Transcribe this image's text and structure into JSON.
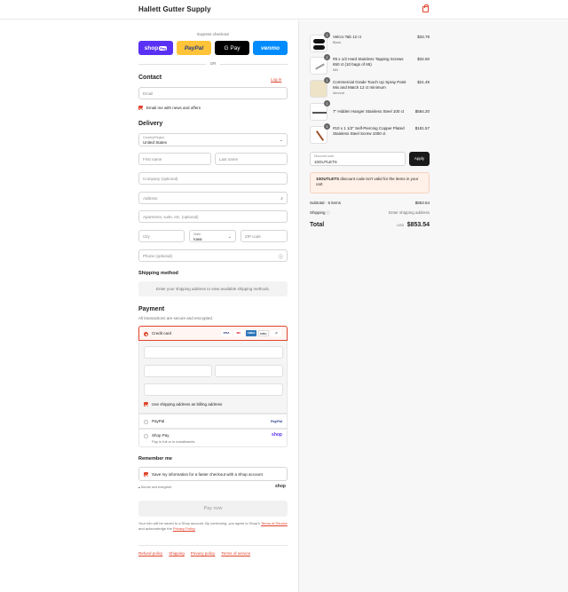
{
  "header": {
    "brand": "Hallett Gutter Supply"
  },
  "express": {
    "label": "Express checkout",
    "shoppay": "shop",
    "shoppay_badge": "Pay",
    "paypal": "PayPal",
    "gpay": "G Pay",
    "venmo": "venmo",
    "or": "OR"
  },
  "contact": {
    "title": "Contact",
    "login": "Log in",
    "email_placeholder": "Email",
    "news_label": "Email me with news and offers"
  },
  "delivery": {
    "title": "Delivery",
    "country_label": "Country/Region",
    "country_value": "United States",
    "first_name": "First name",
    "last_name": "Last name",
    "company": "Company (optional)",
    "address": "Address",
    "apartment": "Apartment, suite, etc. (optional)",
    "city": "City",
    "state_label": "State",
    "state_value": "Iowa",
    "zip": "ZIP code",
    "phone": "Phone (optional)"
  },
  "shipping": {
    "title": "Shipping method",
    "note": "Enter your shipping address to view available shipping methods."
  },
  "payment": {
    "title": "Payment",
    "subtitle": "All transactions are secure and encrypted.",
    "credit_card": "Credit card",
    "card_logos": [
      "VISA",
      "MC",
      "AMEX",
      "DISC",
      "+5"
    ],
    "billing_label": "Use shipping address as billing address",
    "paypal_label": "PayPal",
    "paypal_logo": "PayPal",
    "shoppay_label": "Shop Pay",
    "shoppay_sub": "Pay in full or in installments",
    "shoppay_logo": "shop"
  },
  "remember": {
    "title": "Remember me",
    "save_label": "Save my information for a faster checkout with a Shop account",
    "secure": "Secure and encrypted",
    "shop_logo": "shop"
  },
  "pay_now": "Pay now",
  "legal": {
    "text": "Your info will be saved to a Shop account. By continuing, you agree to Shop's",
    "terms": "Terms of Service",
    "and": "and acknowledge the",
    "privacy": "Privacy Policy"
  },
  "footer": [
    "Refund policy",
    "Shipping",
    "Privacy policy",
    "Terms of service"
  ],
  "cart": {
    "items": [
      {
        "qty": "1",
        "name": "Velcro Tab 12 ct",
        "variant": "Black",
        "price": "$33.78"
      },
      {
        "qty": "1",
        "name": "#8 x 1/2 Hard Stainless Tapping Screws 650 ct (10 bags of 65)",
        "variant": "Mill",
        "price": "$32.50"
      },
      {
        "qty": "1",
        "name": "Commercial Grade Touch Up Spray Paint Mix and Match 12 ct minimum",
        "variant": "Almond",
        "price": "$21.49"
      },
      {
        "qty": "1",
        "name": "7\" Hidden Hanger Stainless Steel 100 ct",
        "variant": "",
        "price": "$584.20"
      },
      {
        "qty": "1",
        "name": "#10 x 1 1/2\" Self-Piercing Copper Plated Stainless Steel Screw 1000 ct",
        "variant": "",
        "price": "$181.57"
      }
    ],
    "discount_label": "Discount code",
    "discount_value": "10OUTLETS",
    "apply": "Apply",
    "alert_code": "10OUTLETS",
    "alert_text": "discount code isn't valid for the items in your cart",
    "subtotal_label": "Subtotal · 5 items",
    "subtotal": "$853.54",
    "shipping_label": "Shipping",
    "shipping_value": "Enter shipping address",
    "total_label": "Total",
    "currency": "USD",
    "total": "$853.54"
  },
  "colors": {
    "accent": "#e0442c",
    "shoppay": "#5a31f4",
    "paypal": "#ffc439",
    "venmo": "#008cff"
  }
}
